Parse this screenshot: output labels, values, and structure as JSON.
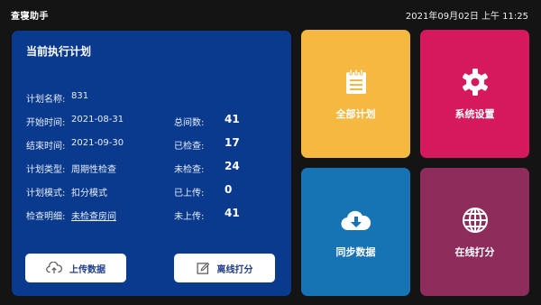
{
  "app": {
    "title": "查寝助手",
    "datetime": "2021年09月02日 上午 11:25"
  },
  "plan": {
    "title": "当前执行计划",
    "rows": [
      {
        "label": "计划名称:",
        "value": "831"
      },
      {
        "label": "开始时间:",
        "value": "2021-08-31",
        "stat_label": "总间数:",
        "stat_value": "41"
      },
      {
        "label": "结束时间:",
        "value": "2021-09-30",
        "stat_label": "已检查:",
        "stat_value": "17"
      },
      {
        "label": "计划类型:",
        "value": "周期性检查",
        "stat_label": "未检查:",
        "stat_value": "24"
      },
      {
        "label": "计划模式:",
        "value": "扣分模式",
        "stat_label": "已上传:",
        "stat_value": "0"
      },
      {
        "label": "检查明细:",
        "value": "未检查房间",
        "stat_label": "未上传:",
        "stat_value": "41"
      }
    ],
    "buttons": {
      "upload": "上传数据",
      "offline": "离线打分"
    }
  },
  "tiles": {
    "all_plans": {
      "label": "全部计划",
      "icon": "notepad-icon",
      "color": "#f5b942"
    },
    "settings": {
      "label": "系统设置",
      "icon": "gear-icon",
      "color": "#d6185d"
    },
    "sync": {
      "label": "同步数据",
      "icon": "cloud-download-icon",
      "color": "#1673b4"
    },
    "online": {
      "label": "在线打分",
      "icon": "globe-icon",
      "color": "#8e2d5c"
    }
  },
  "colors": {
    "background": "#141414",
    "panel": "#0a3a8e",
    "button_text": "#1f3f8a"
  }
}
